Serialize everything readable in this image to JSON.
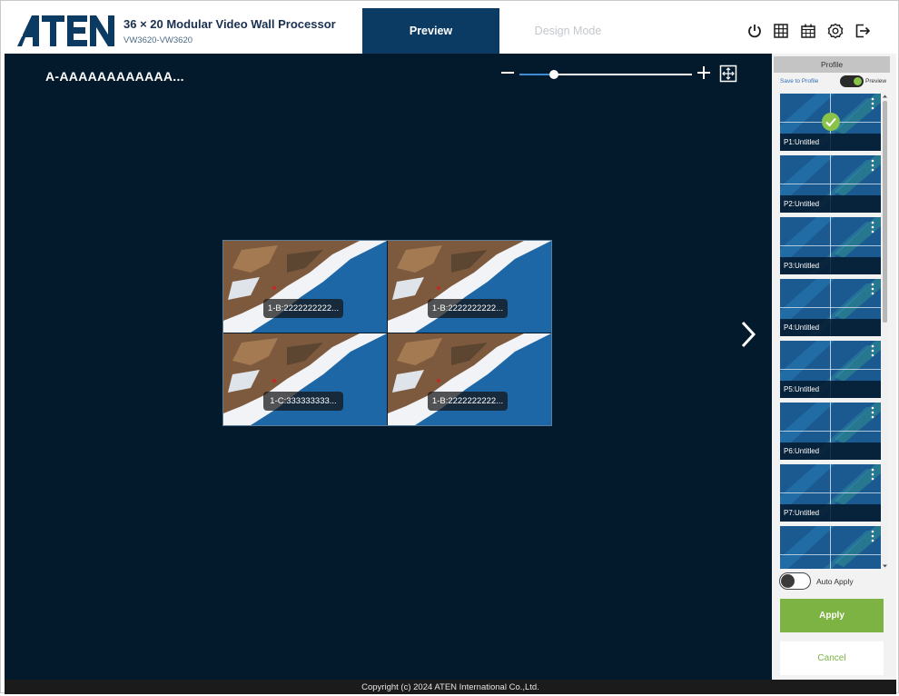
{
  "header": {
    "logo_text": "ATEN",
    "title": "36 × 20 Modular Video Wall Processor",
    "model": "VW3620-VW3620",
    "tabs": [
      {
        "label": "Preview",
        "active": true
      },
      {
        "label": "Design Mode",
        "active": false
      }
    ],
    "icons": [
      "power-icon",
      "grid-icon",
      "calendar-icon",
      "settings-icon",
      "logout-icon"
    ]
  },
  "canvas": {
    "title": "A-AAAAAAAAAAAA...",
    "zoom_level": 0.2,
    "screens": [
      {
        "label": "1-B:2222222222..."
      },
      {
        "label": "1-B:2222222222..."
      },
      {
        "label": "1-C:333333333..."
      },
      {
        "label": "1-B:2222222222..."
      }
    ]
  },
  "panel": {
    "header": "Profile",
    "save_to_profile": "Save to Profile",
    "preview_label": "Preview",
    "preview_on": true,
    "profiles": [
      {
        "name": "P1:Untitled",
        "selected": true
      },
      {
        "name": "P2:Untitled",
        "selected": false
      },
      {
        "name": "P3:Untitled",
        "selected": false
      },
      {
        "name": "P4:Untitled",
        "selected": false
      },
      {
        "name": "P5:Untitled",
        "selected": false
      },
      {
        "name": "P6:Untitled",
        "selected": false
      },
      {
        "name": "P7:Untitled",
        "selected": false
      },
      {
        "name": "",
        "selected": false
      }
    ],
    "auto_apply_label": "Auto Apply",
    "auto_apply_on": false,
    "apply_label": "Apply",
    "cancel_label": "Cancel"
  },
  "footer": {
    "copyright": "Copyright (c) 2024 ATEN International Co.,Ltd."
  },
  "colors": {
    "brand_navy": "#0b3a63",
    "canvas_bg": "#031a2d",
    "accent_green": "#7cb342"
  }
}
